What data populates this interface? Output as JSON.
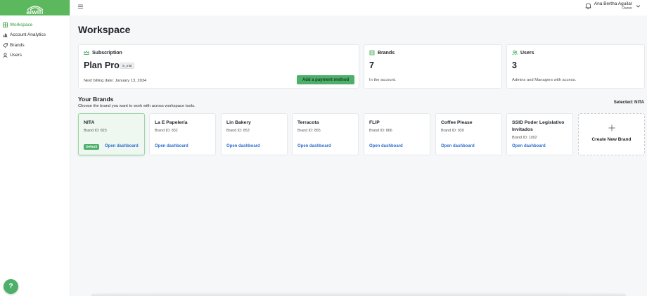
{
  "app": {
    "logo_text": "aiwifi",
    "brand_color": "#5cb85c",
    "accent_color": "#4caf6a",
    "link_color": "#2f6fcf"
  },
  "sidebar": {
    "items": [
      {
        "label": "Workspace",
        "icon": "grid-icon",
        "active": true
      },
      {
        "label": "Account Analytics",
        "icon": "bar-chart-icon",
        "active": false
      },
      {
        "label": "Brands",
        "icon": "tag-icon",
        "active": false
      },
      {
        "label": "Users",
        "icon": "user-icon",
        "active": false
      }
    ],
    "help_label": "?"
  },
  "topbar": {
    "user_name": "Ana Bertha Aguilar",
    "user_role": "Owner"
  },
  "page": {
    "title": "Workspace"
  },
  "subscription": {
    "heading": "Subscription",
    "plan": "Plan Pro",
    "status": "in_trial",
    "billing": "Next billing date: January 13, 2034",
    "button": "Add a payment method"
  },
  "brands_summary": {
    "heading": "Brands",
    "count": "7",
    "desc": "In the account."
  },
  "users_summary": {
    "heading": "Users",
    "count": "3",
    "desc": "Admins and Managers with access."
  },
  "your_brands": {
    "title": "Your Brands",
    "subtitle": "Choose the brand you want to work with across workspace tools.",
    "selected": "Selected: NITA",
    "default_badge": "Default",
    "open_label": "Open dashboard",
    "create_label": "Create New Brand",
    "items": [
      {
        "name": "NITA",
        "id": "Brand ID: 823"
      },
      {
        "name": "La E Papelería",
        "id": "Brand ID: 832"
      },
      {
        "name": "Lin Bakery",
        "id": "Brand ID: 853"
      },
      {
        "name": "Terracota",
        "id": "Brand ID: 855"
      },
      {
        "name": "FLIP",
        "id": "Brand ID: 866"
      },
      {
        "name": "Coffee Please",
        "id": "Brand ID: 939"
      },
      {
        "name": "SSID Poder Legislativo Invitados",
        "id": "Brand ID: 1002"
      }
    ]
  }
}
